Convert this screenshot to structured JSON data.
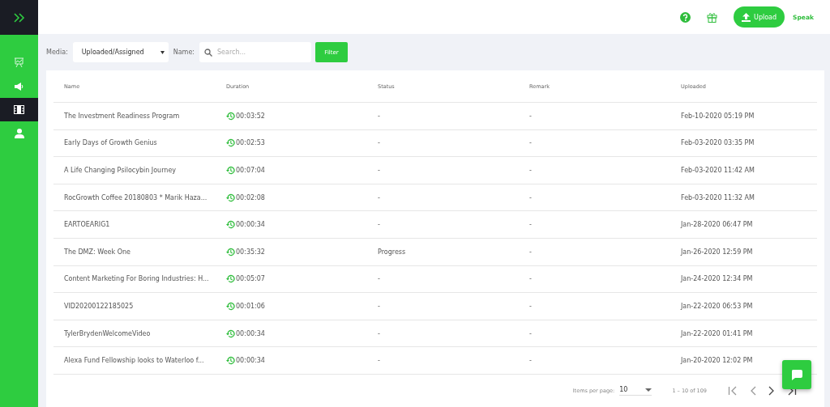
{
  "sidebar": {
    "items": [
      {
        "kind": "presentation",
        "selected": false
      },
      {
        "kind": "speaker",
        "selected": false
      },
      {
        "kind": "film",
        "selected": true
      },
      {
        "kind": "user",
        "selected": false
      }
    ]
  },
  "header": {
    "upload_button": "Upload",
    "speak_link": "Speak"
  },
  "filters": {
    "media_label": "Media:",
    "media_value": "Uploaded/Assigned",
    "name_label": "Name:",
    "search_placeholder": "Search...",
    "filter_button": "Filter"
  },
  "table": {
    "columns": [
      "Name",
      "Duration",
      "Status",
      "Remark",
      "Uploaded"
    ],
    "rows": [
      [
        "The Investment Readiness Program",
        "00:03:52",
        "-",
        "-",
        "Feb-10-2020 05:19 PM"
      ],
      [
        "Early Days of Growth Genius",
        "00:02:53",
        "-",
        "-",
        "Feb-03-2020 03:35 PM"
      ],
      [
        "A Life Changing Psilocybin Journey",
        "00:07:04",
        "-",
        "-",
        "Feb-03-2020 11:42 AM"
      ],
      [
        "RocGrowth Coffee 20180803 * Marik Haza...",
        "00:02:08",
        "-",
        "-",
        "Feb-03-2020 11:32 AM"
      ],
      [
        "EARTOEARIG1",
        "00:00:34",
        "-",
        "-",
        "Jan-28-2020 06:47 PM"
      ],
      [
        "The DMZ: Week One",
        "00:35:32",
        "Progress",
        "-",
        "Jan-26-2020 12:59 PM"
      ],
      [
        "Content Marketing For Boring Industries: H...",
        "00:05:07",
        "-",
        "-",
        "Jan-24-2020 12:34 PM"
      ],
      [
        "VID20200122185025",
        "00:01:06",
        "-",
        "-",
        "Jan-22-2020 06:53 PM"
      ],
      [
        "TylerBrydenWelcomeVideo",
        "00:00:34",
        "-",
        "-",
        "Jan-22-2020 01:41 PM"
      ],
      [
        "Alexa Fund Fellowship looks to Waterloo f...",
        "00:00:34",
        "-",
        "-",
        "Jan-20-2020 12:02 PM"
      ]
    ]
  },
  "paginator": {
    "items_per_page_label": "Items per page:",
    "page_size": "10",
    "range": "1 – 10 of 109"
  }
}
